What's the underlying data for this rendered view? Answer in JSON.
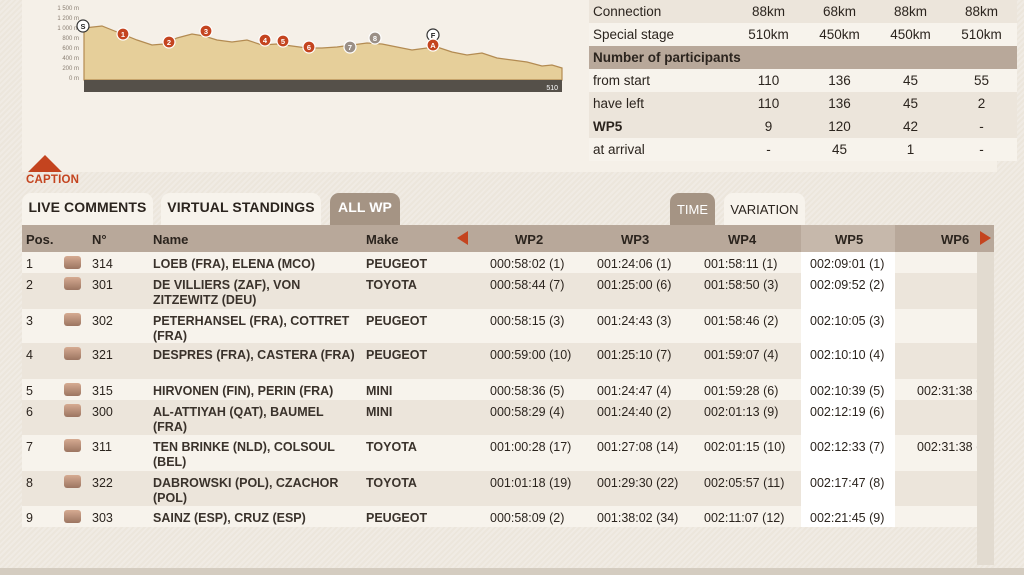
{
  "profile": {
    "y_labels": [
      "1 500 m",
      "1 200 m",
      "1 000 m",
      "800 m",
      "600 m",
      "400 m",
      "200 m",
      "0 m"
    ],
    "distance_end": "510",
    "markers": [
      {
        "label": "S",
        "kind": "start"
      },
      {
        "label": "1",
        "kind": "wp"
      },
      {
        "label": "2",
        "kind": "wp"
      },
      {
        "label": "3",
        "kind": "wp"
      },
      {
        "label": "4",
        "kind": "wp"
      },
      {
        "label": "5",
        "kind": "wp"
      },
      {
        "label": "6",
        "kind": "wp"
      },
      {
        "label": "7",
        "kind": "wp-done"
      },
      {
        "label": "8",
        "kind": "wp-done"
      },
      {
        "label": "F",
        "kind": "finish"
      },
      {
        "label": "A",
        "kind": "arrival"
      }
    ]
  },
  "stats": {
    "rows": [
      {
        "label": "Connection",
        "values": [
          "88km",
          "68km",
          "88km",
          "88km"
        ],
        "style": "odd"
      },
      {
        "label": "Special stage",
        "values": [
          "510km",
          "450km",
          "450km",
          "510km"
        ],
        "style": "even"
      },
      {
        "label": "Number of participants",
        "values": [],
        "style": "head"
      },
      {
        "label": "from start",
        "values": [
          "110",
          "136",
          "45",
          "55"
        ],
        "style": "even"
      },
      {
        "label": "have left",
        "values": [
          "110",
          "136",
          "45",
          "2"
        ],
        "style": "odd"
      },
      {
        "label": "WP5",
        "values": [
          "9",
          "120",
          "42",
          "-"
        ],
        "style": "odd-bold"
      },
      {
        "label": "at arrival",
        "values": [
          "-",
          "45",
          "1",
          "-"
        ],
        "style": "even"
      }
    ]
  },
  "caption": {
    "label": "CAPTION"
  },
  "tabs": {
    "live_comments": "LIVE COMMENTS",
    "virtual_standings": "VIRTUAL STANDINGS",
    "all_wp": "ALL WP",
    "time": "TIME",
    "variation": "VARIATION"
  },
  "table": {
    "headers": {
      "pos": "Pos.",
      "num": "N°",
      "name": "Name",
      "make": "Make",
      "wp2": "WP2",
      "wp3": "WP3",
      "wp4": "WP4",
      "wp5": "WP5",
      "wp6": "WP6"
    },
    "rows": [
      {
        "pos": "1",
        "num": "314",
        "name": "LOEB (FRA), ELENA (MCO)",
        "make": "PEUGEOT",
        "wp2": "000:58:02 (1)",
        "wp3": "001:24:06 (1)",
        "wp4": "001:58:11 (1)",
        "wp5": "002:09:01 (1)",
        "wp6": ""
      },
      {
        "pos": "2",
        "num": "301",
        "name": "DE VILLIERS (ZAF), VON ZITZEWITZ (DEU)",
        "make": "TOYOTA",
        "wp2": "000:58:44 (7)",
        "wp3": "001:25:00 (6)",
        "wp4": "001:58:50 (3)",
        "wp5": "002:09:52 (2)",
        "wp6": ""
      },
      {
        "pos": "3",
        "num": "302",
        "name": "PETERHANSEL (FRA), COTTRET (FRA)",
        "make": "PEUGEOT",
        "wp2": "000:58:15 (3)",
        "wp3": "001:24:43 (3)",
        "wp4": "001:58:46 (2)",
        "wp5": "002:10:05 (3)",
        "wp6": ""
      },
      {
        "pos": "4",
        "num": "321",
        "name": "DESPRES (FRA), CASTERA (FRA)",
        "make": "PEUGEOT",
        "wp2": "000:59:00 (10)",
        "wp3": "001:25:10 (7)",
        "wp4": "001:59:07 (4)",
        "wp5": "002:10:10 (4)",
        "wp6": ""
      },
      {
        "pos": "5",
        "num": "315",
        "name": "HIRVONEN (FIN), PERIN (FRA)",
        "make": "MINI",
        "wp2": "000:58:36 (5)",
        "wp3": "001:24:47 (4)",
        "wp4": "001:59:28 (6)",
        "wp5": "002:10:39 (5)",
        "wp6": "002:31:38 ("
      },
      {
        "pos": "6",
        "num": "300",
        "name": "AL-ATTIYAH (QAT), BAUMEL (FRA)",
        "make": "MINI",
        "wp2": "000:58:29 (4)",
        "wp3": "001:24:40 (2)",
        "wp4": "002:01:13 (9)",
        "wp5": "002:12:19 (6)",
        "wp6": ""
      },
      {
        "pos": "7",
        "num": "311",
        "name": "TEN BRINKE (NLD), COLSOUL (BEL)",
        "make": "TOYOTA",
        "wp2": "001:00:28 (17)",
        "wp3": "001:27:08 (14)",
        "wp4": "002:01:15 (10)",
        "wp5": "002:12:33 (7)",
        "wp6": "002:31:38 ("
      },
      {
        "pos": "8",
        "num": "322",
        "name": "DABROWSKI (POL), CZACHOR (POL)",
        "make": "TOYOTA",
        "wp2": "001:01:18 (19)",
        "wp3": "001:29:30 (22)",
        "wp4": "002:05:57 (11)",
        "wp5": "002:17:47 (8)",
        "wp6": ""
      },
      {
        "pos": "9",
        "num": "303",
        "name": "SAINZ (ESP), CRUZ (ESP)",
        "make": "PEUGEOT",
        "wp2": "000:58:09 (2)",
        "wp3": "001:38:02 (34)",
        "wp4": "002:11:07 (12)",
        "wp5": "002:21:45 (9)",
        "wp6": ""
      }
    ]
  },
  "colors": {
    "accent": "#c4441f",
    "header": "#b8a89a",
    "tab_active": "#a59484"
  }
}
